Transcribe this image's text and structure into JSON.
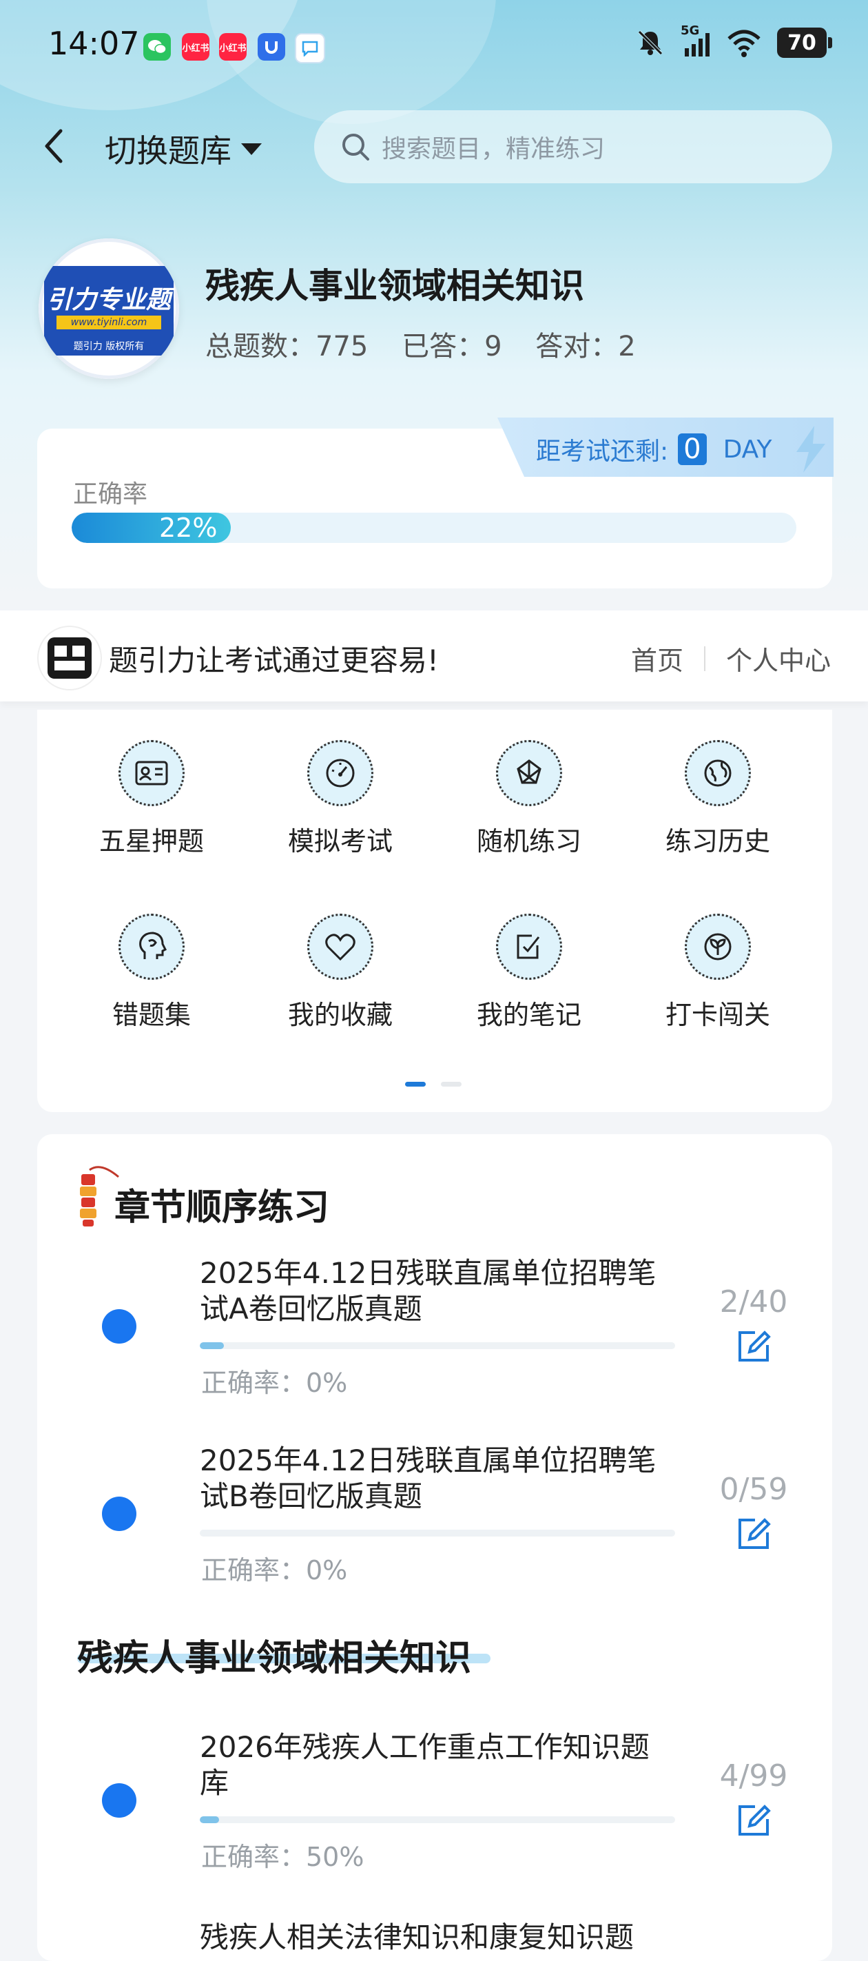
{
  "status_bar": {
    "time": "14:07",
    "apps": [
      {
        "name": "wechat-icon",
        "color": "#2bc45f",
        "label": ""
      },
      {
        "name": "xiaohongshu-icon",
        "color": "#ff2442",
        "label": "小红书"
      },
      {
        "name": "xiaohongshu-icon",
        "color": "#ff2442",
        "label": "小红书"
      },
      {
        "name": "u-app-icon",
        "color": "#2f6fe9",
        "label": ""
      },
      {
        "name": "chat-bubble-icon",
        "color": "#2fa3ec",
        "label": ""
      }
    ],
    "network": "5G",
    "battery": "70"
  },
  "header": {
    "switch_label": "切换题库",
    "search_placeholder": "搜索题目，精准练习"
  },
  "bank": {
    "logo_text": "引力专业题",
    "logo_url": "www.tiyinli.com",
    "logo_footer": "题引力 版权所有",
    "title": "残疾人事业领域相关知识",
    "total_label": "总题数：775",
    "answered_label": "已答：9",
    "correct_label": "答对：2"
  },
  "exam": {
    "countdown_label": "距考试还剩:",
    "days": "0",
    "unit": "DAY"
  },
  "accuracy": {
    "label": "正确率",
    "value": 0.22,
    "value_text": "22%"
  },
  "brand_strip": {
    "slogan": "题引力让考试通过更容易!",
    "nav_home": "首页",
    "nav_profile": "个人中心"
  },
  "grid": [
    {
      "label": "五星押题",
      "icon": "id-card-icon"
    },
    {
      "label": "模拟考试",
      "icon": "gauge-icon"
    },
    {
      "label": "随机练习",
      "icon": "shuffle-icon"
    },
    {
      "label": "练习历史",
      "icon": "globe-icon"
    },
    {
      "label": "错题集",
      "icon": "head-icon"
    },
    {
      "label": "我的收藏",
      "icon": "heart-icon"
    },
    {
      "label": "我的笔记",
      "icon": "note-check-icon"
    },
    {
      "label": "打卡闯关",
      "icon": "sprout-icon"
    }
  ],
  "practice": {
    "section1_title": "章节顺序练习",
    "section2_title": "残疾人事业领域相关知识",
    "rows": [
      {
        "title": "2025年4.12日残联直属单位招聘笔试A卷回忆版真题",
        "count": "2/40",
        "progress": 0.05,
        "accuracy": "正确率：0%"
      },
      {
        "title": "2025年4.12日残联直属单位招聘笔试B卷回忆版真题",
        "count": "0/59",
        "progress": 0.0,
        "accuracy": "正确率：0%"
      },
      {
        "title": "2026年残疾人工作重点工作知识题库",
        "count": "4/99",
        "progress": 0.04,
        "accuracy": "正确率：50%"
      }
    ],
    "partial_row": "残疾人相关法律知识和康复知识题"
  }
}
